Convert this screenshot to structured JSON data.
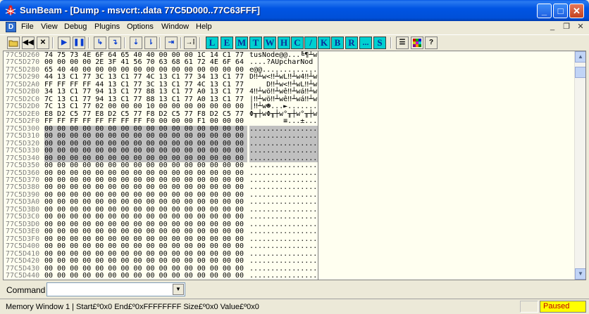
{
  "window": {
    "app_name": "SunBeam",
    "title": "SunBeam - [Dump - msvcrt:.data 77C5D000..77C63FFF]",
    "minimize": "_",
    "maximize": "□",
    "close": "✕"
  },
  "menu": {
    "doc_icon": "D",
    "items": [
      "File",
      "View",
      "Debug",
      "Plugins",
      "Options",
      "Window",
      "Help"
    ],
    "mdi": [
      "_",
      "❐",
      "✕"
    ]
  },
  "toolbar": {
    "letters": [
      "L",
      "E",
      "M",
      "T",
      "W",
      "H",
      "C",
      "/",
      "K",
      "B",
      "R",
      "...",
      "S"
    ]
  },
  "dump": {
    "rows": [
      {
        "addr": "77C5D260",
        "hex": "74 75 73 4E 6F 64 65 40 40 00 00 00 1C 14 C1 77",
        "ascii": "tusNode@@...╚¶┴w"
      },
      {
        "addr": "77C5D270",
        "hex": "00 00 00 00 2E 3F 41 56 70 63 68 61 72 4E 6F 64",
        "ascii": "....?AUpcharNod"
      },
      {
        "addr": "77C5D280",
        "hex": "65 40 40 00 00 00 00 00 00 00 00 00 00 00 00 00",
        "ascii": "e@@............."
      },
      {
        "addr": "77C5D290",
        "hex": "44 13 C1 77 3C 13 C1 77 4C 13 C1 77 34 13 C1 77",
        "ascii": "D‼┴w<‼┴wL‼┴w4‼┴w"
      },
      {
        "addr": "77C5D2A0",
        "hex": "FF FF FF FF 44 13 C1 77 3C 13 C1 77 4C 13 C1 77",
        "ascii": "    D‼┴w<‼┴wL‼┴w"
      },
      {
        "addr": "77C5D2B0",
        "hex": "34 13 C1 77 94 13 C1 77 88 13 C1 77 A0 13 C1 77",
        "ascii": "4‼┴wö‼┴wê‼┴wá‼┴w"
      },
      {
        "addr": "77C5D2C0",
        "hex": "7C 13 C1 77 94 13 C1 77 88 13 C1 77 A0 13 C1 77",
        "ascii": "|‼┴wö‼┴wê‼┴wá‼┴w"
      },
      {
        "addr": "77C5D2D0",
        "hex": "7C 13 C1 77 02 00 00 00 10 00 00 00 00 00 00 00",
        "ascii": "|‼┴w☻...►......."
      },
      {
        "addr": "77C5D2E0",
        "hex": "E8 D2 C5 77 E8 D2 C5 77 F8 D2 C5 77 F8 D2 C5 77",
        "ascii": "Φ╥┼wΦ╥┼w°╥┼w°╥┼w"
      },
      {
        "addr": "77C5D2F0",
        "hex": "FF FF FF FF FF FF FF FF F0 00 00 00 F1 00 00 00",
        "ascii": "        ≡...±..."
      },
      {
        "addr": "77C5D300",
        "hex": "00 00 00 00 00 00 00 00 00 00 00 00 00 00 00 00",
        "ascii": "................"
      },
      {
        "addr": "77C5D310",
        "hex": "00 00 00 00 00 00 00 00 00 00 00 00 00 00 00 00",
        "ascii": "................"
      },
      {
        "addr": "77C5D320",
        "hex": "00 00 00 00 00 00 00 00 00 00 00 00 00 00 00 00",
        "ascii": "................"
      },
      {
        "addr": "77C5D330",
        "hex": "00 00 00 00 00 00 00 00 00 00 00 00 00 00 00 00",
        "ascii": "................"
      },
      {
        "addr": "77C5D340",
        "hex": "00 00 00 00 00 00 00 00 00 00 00 00 00 00 00 00",
        "ascii": "................"
      },
      {
        "addr": "77C5D350",
        "hex": "00 00 00 00 00 00 00 00 00 00 00 00 00 00 00 00",
        "ascii": "................"
      },
      {
        "addr": "77C5D360",
        "hex": "00 00 00 00 00 00 00 00 00 00 00 00 00 00 00 00",
        "ascii": "................"
      },
      {
        "addr": "77C5D370",
        "hex": "00 00 00 00 00 00 00 00 00 00 00 00 00 00 00 00",
        "ascii": "................"
      },
      {
        "addr": "77C5D380",
        "hex": "00 00 00 00 00 00 00 00 00 00 00 00 00 00 00 00",
        "ascii": "................"
      },
      {
        "addr": "77C5D390",
        "hex": "00 00 00 00 00 00 00 00 00 00 00 00 00 00 00 00",
        "ascii": "................"
      },
      {
        "addr": "77C5D3A0",
        "hex": "00 00 00 00 00 00 00 00 00 00 00 00 00 00 00 00",
        "ascii": "................"
      },
      {
        "addr": "77C5D3B0",
        "hex": "00 00 00 00 00 00 00 00 00 00 00 00 00 00 00 00",
        "ascii": "................"
      },
      {
        "addr": "77C5D3C0",
        "hex": "00 00 00 00 00 00 00 00 00 00 00 00 00 00 00 00",
        "ascii": "................"
      },
      {
        "addr": "77C5D3D0",
        "hex": "00 00 00 00 00 00 00 00 00 00 00 00 00 00 00 00",
        "ascii": "................"
      },
      {
        "addr": "77C5D3E0",
        "hex": "00 00 00 00 00 00 00 00 00 00 00 00 00 00 00 00",
        "ascii": "................"
      },
      {
        "addr": "77C5D3F0",
        "hex": "00 00 00 00 00 00 00 00 00 00 00 00 00 00 00 00",
        "ascii": "................"
      },
      {
        "addr": "77C5D400",
        "hex": "00 00 00 00 00 00 00 00 00 00 00 00 00 00 00 00",
        "ascii": "................"
      },
      {
        "addr": "77C5D410",
        "hex": "00 00 00 00 00 00 00 00 00 00 00 00 00 00 00 00",
        "ascii": "................"
      },
      {
        "addr": "77C5D420",
        "hex": "00 00 00 00 00 00 00 00 00 00 00 00 00 00 00 00",
        "ascii": "................"
      },
      {
        "addr": "77C5D430",
        "hex": "00 00 00 00 00 00 00 00 00 00 00 00 00 00 00 00",
        "ascii": "................"
      },
      {
        "addr": "77C5D440",
        "hex": "00 00 00 00 00 00 00 00 00 00 00 00 00 00 00 00",
        "ascii": "................"
      },
      {
        "addr": "77C5D450",
        "hex": "00 00 00 00 00 00 00 00 00 00 00 00 00 00 00 00",
        "ascii": "................"
      },
      {
        "addr": "77C5D460",
        "hex": "00 00 00 00 00 00 00 00 00 00 00 00 00 00 00 00",
        "ascii": "................"
      },
      {
        "addr": "77C5D470",
        "hex": "00 00 00 00 00 00 00 00 00 00 00 00 00 00 00 00",
        "ascii": "................"
      },
      {
        "addr": "77C5D480",
        "hex": "00 00 00 00 00 00 00 00 00 00 00 00 00 00 00 00",
        "ascii": "................"
      },
      {
        "addr": "77C5D490",
        "hex": "00 00 00 00 00 00 00 00 00 00 00 00 00 00 00 00",
        "ascii": "................"
      }
    ],
    "selected_rows": [
      "77C5D300",
      "77C5D310",
      "77C5D320",
      "77C5D330",
      "77C5D340"
    ]
  },
  "command": {
    "label": "Command",
    "value": ""
  },
  "status": {
    "text": "Memory Window 1 | Start£º0x0  End£º0xFFFFFFFF  Size£º0x0 Value£º0x0",
    "state": "Paused"
  },
  "colors": {
    "title_bar": "#0054e3",
    "dump_background": "#fffff0",
    "selection": "#c0c0c0",
    "toolbar_letter_bg": "#00d0d0",
    "paused_bg": "#ffff00",
    "paused_text": "#c00000"
  }
}
